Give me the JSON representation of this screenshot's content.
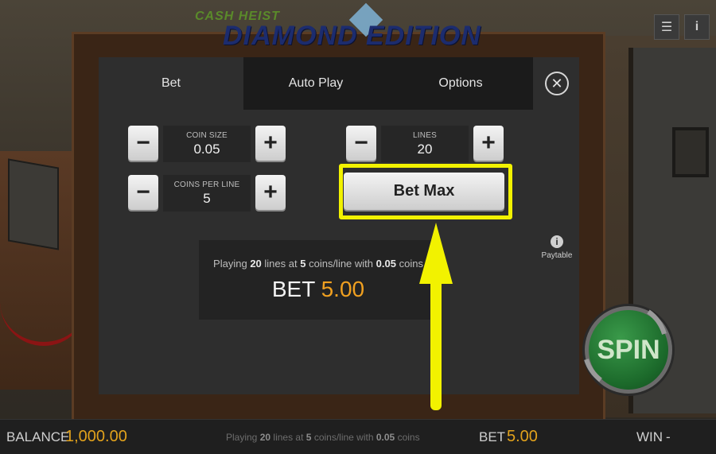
{
  "game": {
    "logo_top": "CASH HEIST",
    "logo_main": "DIAMOND EDITION"
  },
  "top_icons": {
    "menu_icon": "☰",
    "info_icon": "i"
  },
  "tabs": [
    {
      "label": "Bet",
      "active": true
    },
    {
      "label": "Auto Play",
      "active": false
    },
    {
      "label": "Options",
      "active": false
    }
  ],
  "close_label": "✕",
  "steppers": {
    "coin_size": {
      "label": "COIN SIZE",
      "value": "0.05"
    },
    "coins_per_line": {
      "label": "COINS PER LINE",
      "value": "5"
    },
    "lines": {
      "label": "LINES",
      "value": "20"
    },
    "minus": "−",
    "plus": "+"
  },
  "bet_max_label": "Bet Max",
  "paytable": {
    "icon": "i",
    "label": "Paytable"
  },
  "summary": {
    "prefix": "Playing",
    "lines": "20",
    "mid1": "lines at",
    "coins": "5",
    "mid2": "coins/line with",
    "coin_size": "0.05",
    "suffix": "coins",
    "bet_label": "BET",
    "bet_value": "5.00"
  },
  "bottom_bar": {
    "balance_label": "BALANCE",
    "balance_value": "1,000.00",
    "info_prefix": "Playing",
    "info_lines": "20",
    "info_mid1": "lines at",
    "info_coins": "5",
    "info_mid2": "coins/line with",
    "info_coin_size": "0.05",
    "info_suffix": "coins",
    "bet_label": "BET",
    "bet_value": "5.00",
    "win_label": "WIN",
    "win_value": "-"
  },
  "spin_label": "SPIN",
  "colors": {
    "accent": "#f0a020",
    "highlight": "#f2f200",
    "panel": "#2e2e2e",
    "spin_green": "#1c6a2b"
  }
}
